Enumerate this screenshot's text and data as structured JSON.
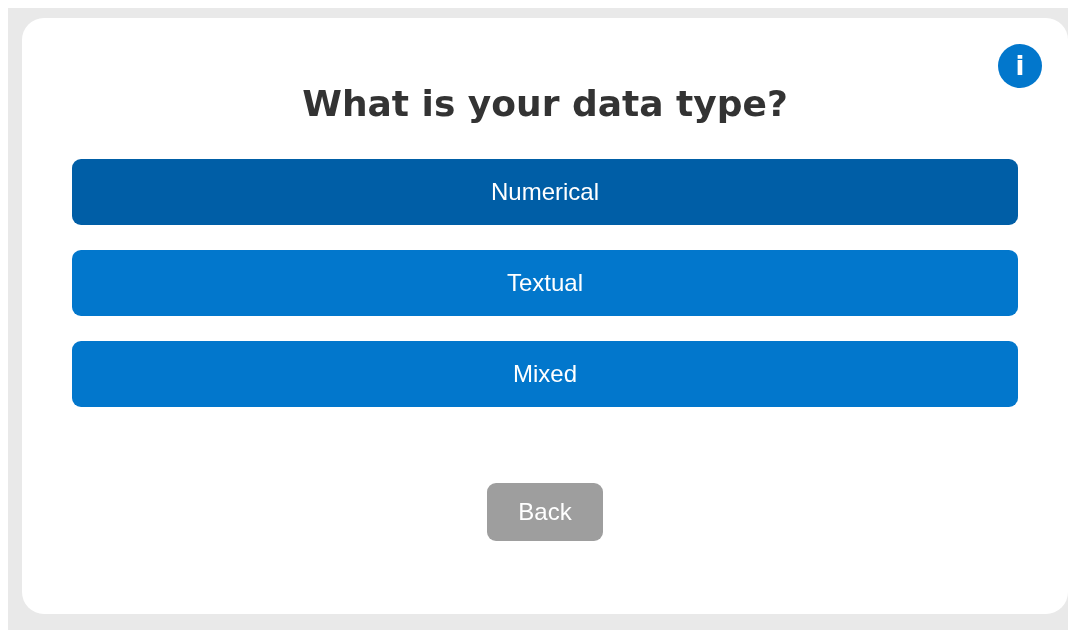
{
  "info_button": {
    "label": "i"
  },
  "title": "What is your data type?",
  "options": [
    {
      "label": "Numerical",
      "selected": true
    },
    {
      "label": "Textual",
      "selected": false
    },
    {
      "label": "Mixed",
      "selected": false
    }
  ],
  "back_button": {
    "label": "Back"
  }
}
